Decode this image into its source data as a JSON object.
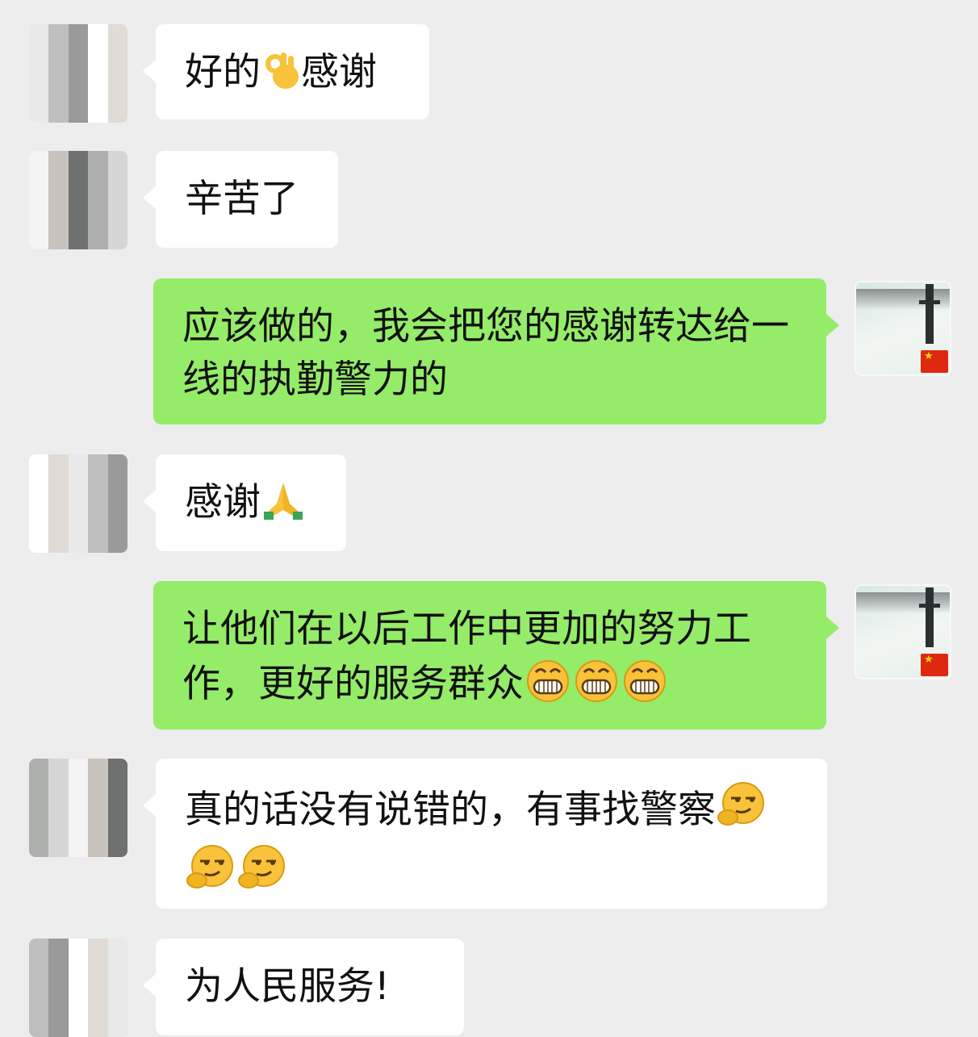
{
  "chat": {
    "messages": [
      {
        "sender": "other",
        "text_before": "好的",
        "emoji": "ok-hand",
        "text_after": "感谢"
      },
      {
        "sender": "other",
        "text": "辛苦了"
      },
      {
        "sender": "me",
        "text": "应该做的，我会把您的感谢转达给一线的执勤警力的"
      },
      {
        "sender": "other",
        "text": "感谢",
        "emoji": "folded-hands"
      },
      {
        "sender": "me",
        "text": "让他们在以后工作中更加的努力工作，更好的服务群众",
        "emojis": [
          "grin",
          "grin",
          "grin"
        ]
      },
      {
        "sender": "other",
        "text": "真的话没有说错的，有事找警察",
        "emojis": [
          "sly-smirk",
          "sly-smirk",
          "sly-smirk"
        ]
      },
      {
        "sender": "other",
        "text": "为人民服务!"
      }
    ]
  },
  "colors": {
    "background": "#ededed",
    "incoming_bubble": "#ffffff",
    "outgoing_bubble": "#95ec69",
    "flag": "#de2910"
  }
}
